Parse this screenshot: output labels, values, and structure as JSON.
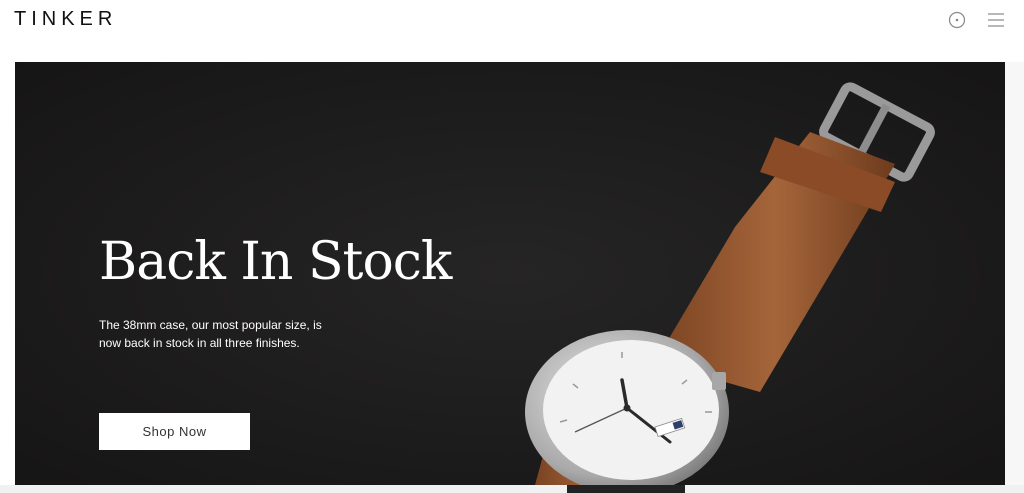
{
  "header": {
    "logo": "TINKER",
    "icons": [
      "account-icon",
      "menu-icon"
    ]
  },
  "hero": {
    "title": "Back In Stock",
    "description": "The 38mm case, our most popular size, is now back in stock in all three finishes.",
    "cta_label": "Shop Now"
  },
  "colors": {
    "hero_background": "#1c1b1b",
    "strap": "#9a5a32",
    "watch_case": "#c9c9c9",
    "dial": "#f4f4f4"
  }
}
